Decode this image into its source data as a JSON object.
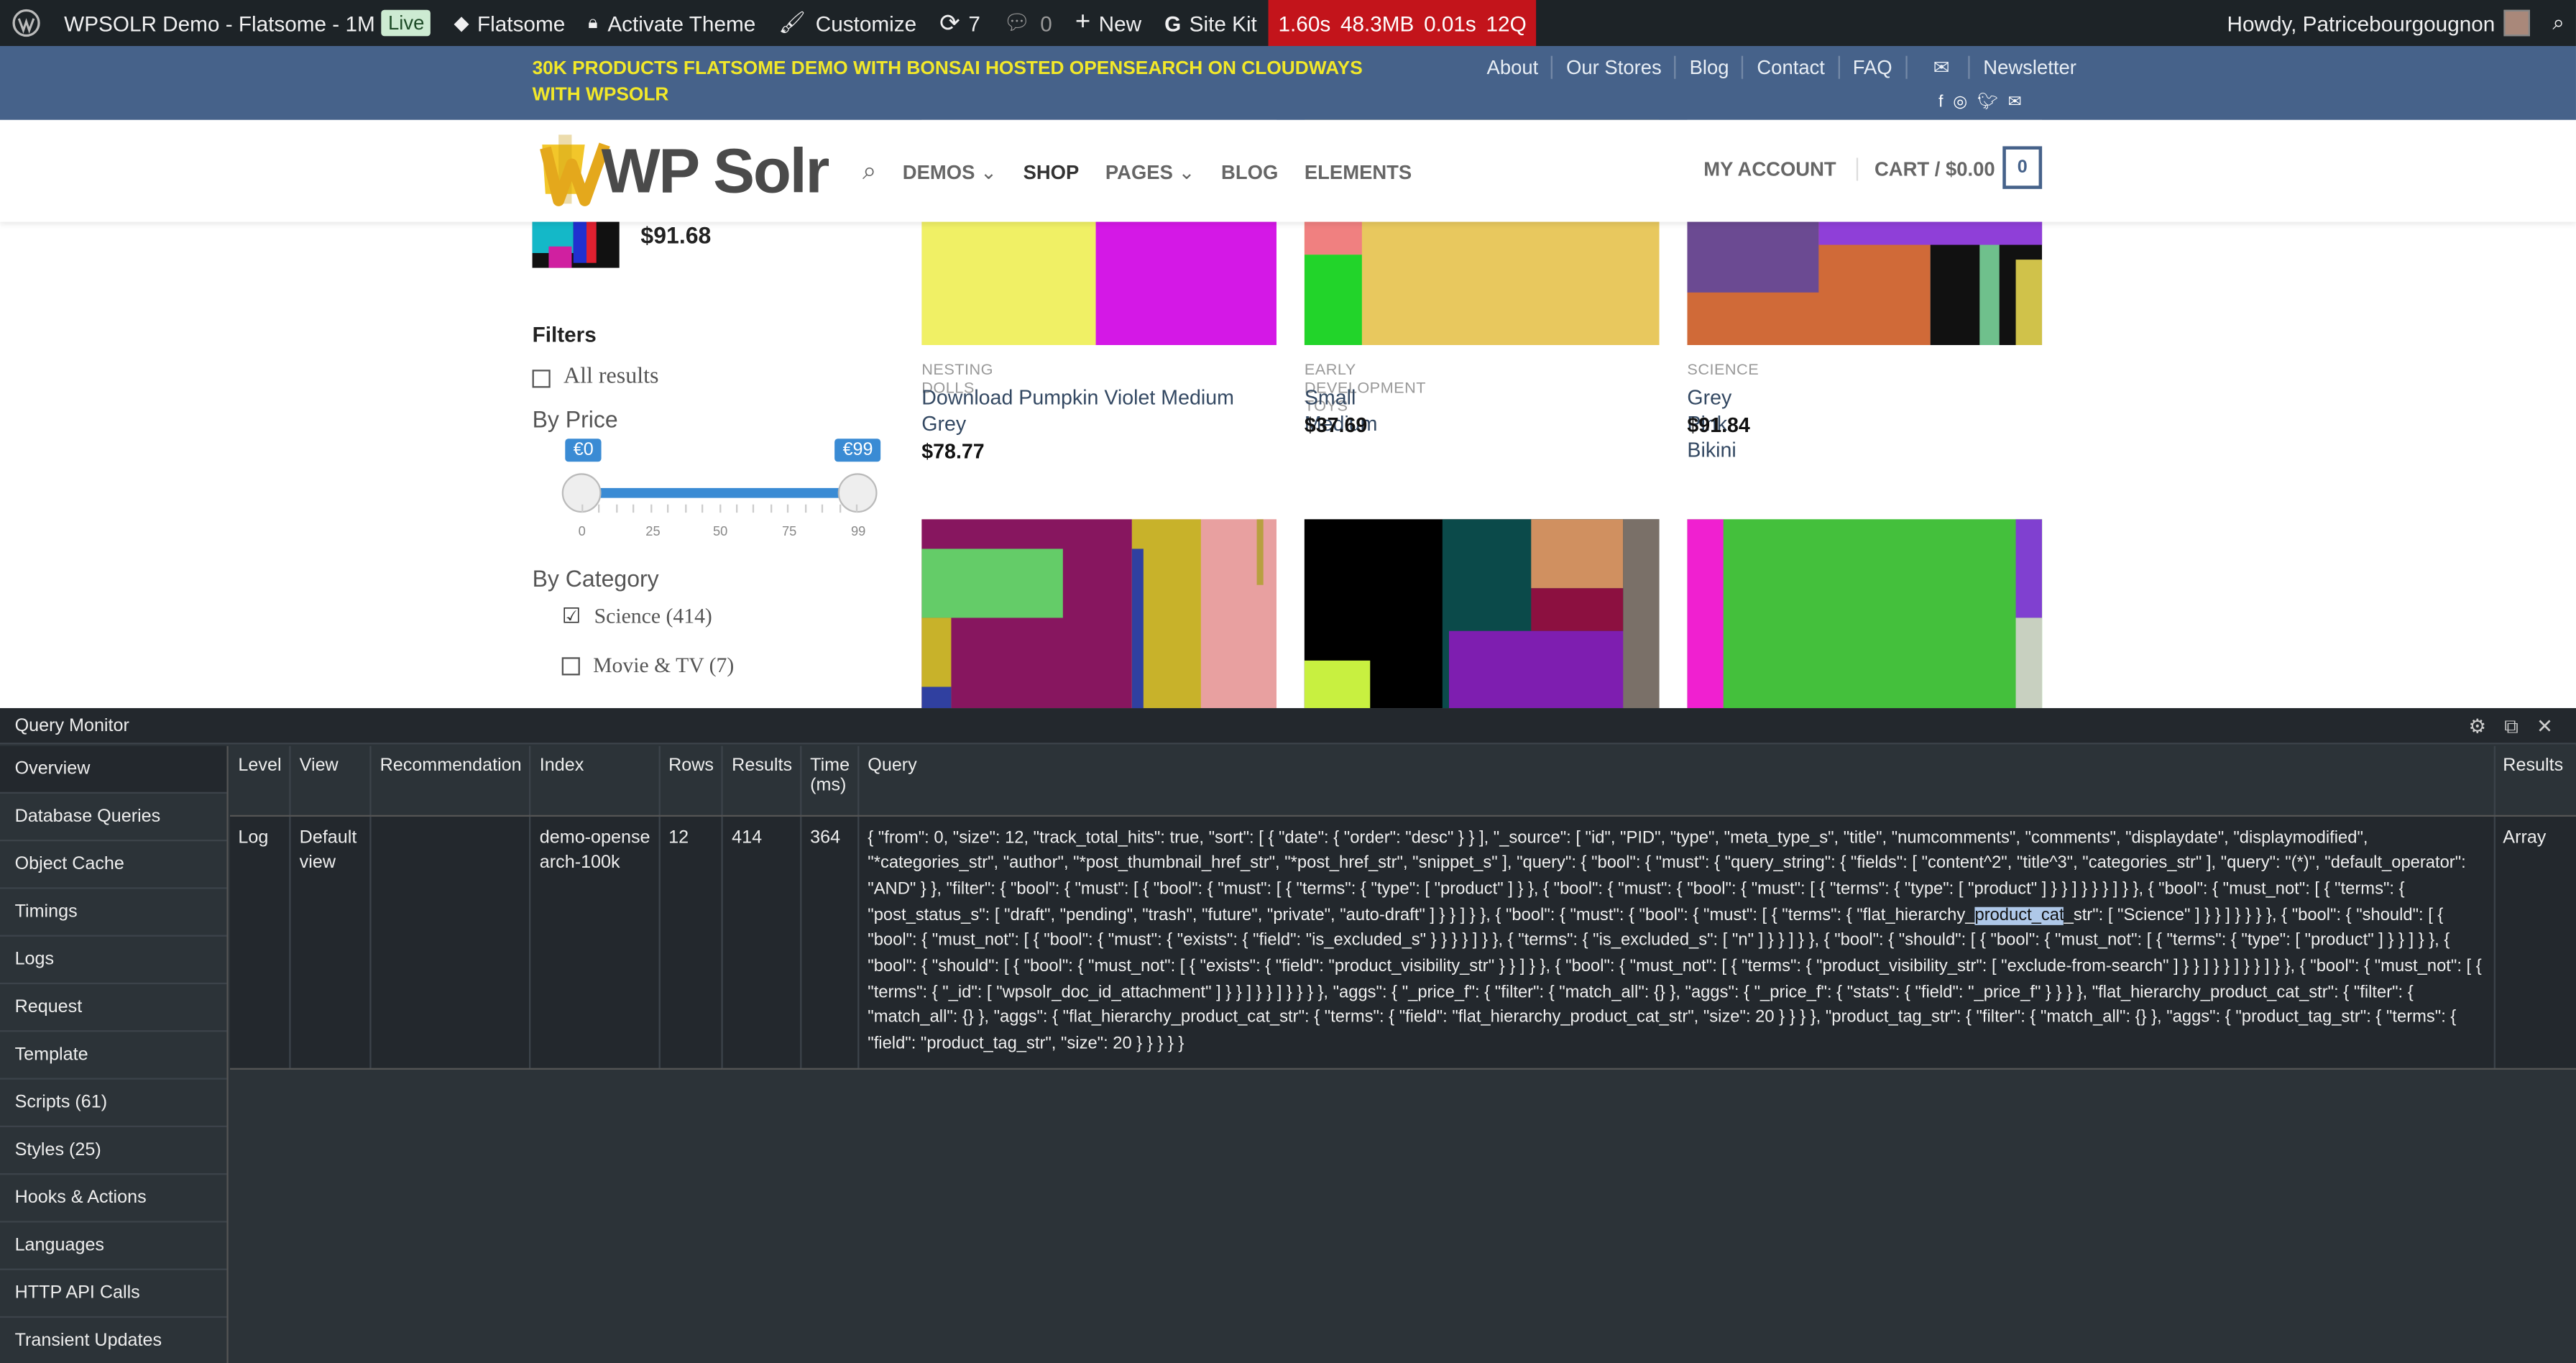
{
  "adminbar": {
    "site": "WPSOLR Demo - Flatsome - 1M",
    "live": "Live",
    "theme": "Flatsome",
    "activate": "Activate Theme",
    "customize": "Customize",
    "updates": "7",
    "comments": "0",
    "new": "New",
    "sitekit": "Site Kit",
    "perf": [
      "1.60s",
      "48.3MB",
      "0.01s",
      "12Q"
    ],
    "howdy": "Howdy, Patricebourgougnon"
  },
  "topbar": {
    "promo": "30K PRODUCTS FLATSOME DEMO WITH BONSAI HOSTED OPENSEARCH ON CLOUDWAYS WITH WPSOLR",
    "nav": [
      "About",
      "Our Stores",
      "Blog",
      "Contact",
      "FAQ",
      "Newsletter"
    ]
  },
  "header": {
    "logo": "WP Solr",
    "nav": [
      "DEMOS",
      "SHOP",
      "PAGES",
      "BLOG",
      "ELEMENTS"
    ],
    "account": "MY ACCOUNT",
    "cart": "CART / $0.00",
    "cart_count": "0"
  },
  "sidebar": {
    "recent_price": "$91.68",
    "filters": "Filters",
    "all_results": "All results",
    "by_price": "By Price",
    "price_min": "€0",
    "price_max": "€99",
    "ticks": [
      "0",
      "25",
      "50",
      "75",
      "99"
    ],
    "by_category": "By Category",
    "categories": [
      {
        "label": "Science (414)",
        "checked": true
      },
      {
        "label": "Movie & TV (7)",
        "checked": false
      }
    ]
  },
  "products": [
    {
      "category": "NESTING DOLLS",
      "name": "Download Pumpkin Violet Medium Grey",
      "price": "$78.77"
    },
    {
      "category": "EARLY DEVELOPMENT TOYS",
      "name": "Small Medium",
      "price": "$37.69"
    },
    {
      "category": "SCIENCE",
      "name": "Grey Pink Bikini",
      "price": "$91.84"
    }
  ],
  "qm": {
    "title": "Query Monitor",
    "menu": [
      "Overview",
      "Database Queries",
      "Object Cache",
      "Timings",
      "Logs",
      "Request",
      "Template",
      "Scripts (61)",
      "Styles (25)",
      "Hooks & Actions",
      "Languages",
      "HTTP API Calls",
      "Transient Updates"
    ],
    "headers": [
      "Level",
      "View",
      "Recommendation",
      "Index",
      "Rows",
      "Results",
      "Time (ms)",
      "Query",
      "Results"
    ],
    "row": {
      "level": "Log",
      "view": "Default view",
      "recommendation": "",
      "index": "demo-opensearch-100k",
      "rows": "12",
      "results": "414",
      "time": "364",
      "query_before": "{ \"from\": 0, \"size\": 12, \"track_total_hits\": true, \"sort\": [ { \"date\": { \"order\": \"desc\" } } ], \"_source\": [ \"id\", \"PID\", \"type\", \"meta_type_s\", \"title\", \"numcomments\", \"comments\", \"displaydate\", \"displaymodified\", \"*categories_str\", \"author\", \"*post_thumbnail_href_str\", \"*post_href_str\", \"snippet_s\" ], \"query\": { \"bool\": { \"must\": { \"query_string\": { \"fields\": [ \"content^2\", \"title^3\", \"categories_str\" ], \"query\": \"(*)\", \"default_operator\": \"AND\" } }, \"filter\": { \"bool\": { \"must\": [ { \"bool\": { \"must\": [ { \"terms\": { \"type\": [ \"product\" ] } }, { \"bool\": { \"must\": { \"bool\": { \"must\": [ { \"terms\": { \"type\": [ \"product\" ] } } ] } } } ] } }, { \"bool\": { \"must_not\": [ { \"terms\": { \"post_status_s\": [ \"draft\", \"pending\", \"trash\", \"future\", \"private\", \"auto-draft\" ] } } ] } }, { \"bool\": { \"must\": { \"bool\": { \"must\": [ { \"terms\": { \"flat_hierarchy_",
      "query_highlight": "product_cat",
      "query_after": "_str\": [ \"Science\" ] } } ] } } } }, { \"bool\": { \"should\": [ { \"bool\": { \"must_not\": [ { \"bool\": { \"must\": { \"exists\": { \"field\": \"is_excluded_s\" } } } } ] } }, { \"terms\": { \"is_excluded_s\": [ \"n\" ] } } ] } }, { \"bool\": { \"should\": [ { \"bool\": { \"must_not\": [ { \"terms\": { \"type\": [ \"product\" ] } } ] } }, { \"bool\": { \"should\": [ { \"bool\": { \"must_not\": [ { \"exists\": { \"field\": \"product_visibility_str\" } } ] } }, { \"bool\": { \"must_not\": [ { \"terms\": { \"product_visibility_str\": [ \"exclude-from-search\" ] } } ] } } ] } } ] } }, { \"bool\": { \"must_not\": [ { \"terms\": { \"_id\": [ \"wpsolr_doc_id_attachment\" ] } } ] } } ] } } } }, \"aggs\": { \"_price_f\": { \"filter\": { \"match_all\": {} }, \"aggs\": { \"_price_f\": { \"stats\": { \"field\": \"_price_f\" } } } }, \"flat_hierarchy_product_cat_str\": { \"filter\": { \"match_all\": {} }, \"aggs\": { \"flat_hierarchy_product_cat_str\": { \"terms\": { \"field\": \"flat_hierarchy_product_cat_str\", \"size\": 20 } } } }, \"product_tag_str\": { \"filter\": { \"match_all\": {} }, \"aggs\": { \"product_tag_str\": { \"terms\": { \"field\": \"product_tag_str\", \"size\": 20 } } } } }",
      "results_type": "Array"
    }
  }
}
